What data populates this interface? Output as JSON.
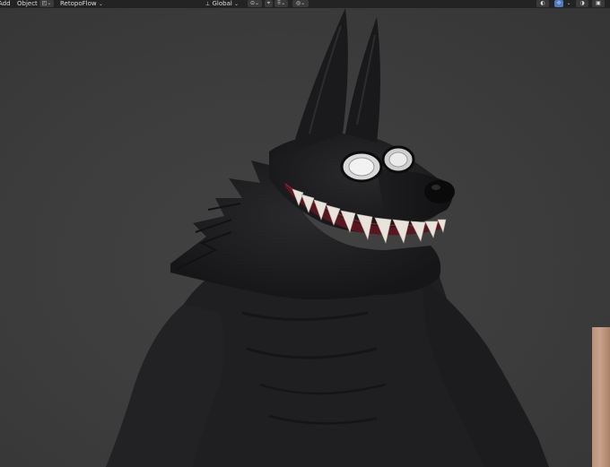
{
  "header": {
    "menu_add": "Add",
    "menu_object": "Object",
    "addon_retopoflow": "RetopoFlow",
    "transform_orientation": "Global"
  },
  "icons": {
    "header_left": [
      "editor-type-icon",
      "chevron-down-icon"
    ],
    "header_center": [
      "orientation-icon",
      "pivot-icon",
      "snap-icon",
      "snap-increment-icon",
      "proportional-edit-icon"
    ],
    "header_right": [
      "visibility-icon",
      "gizmo-icon",
      "overlay-icon",
      "xray-icon"
    ]
  },
  "colors": {
    "header_bg": "#232323",
    "viewport_bg": "#3d3d3d",
    "model_fur": "#1c1c1e",
    "teeth": "#e8e3dc",
    "gums": "#8a1f2a",
    "accent_active": "#4f7bbf"
  }
}
